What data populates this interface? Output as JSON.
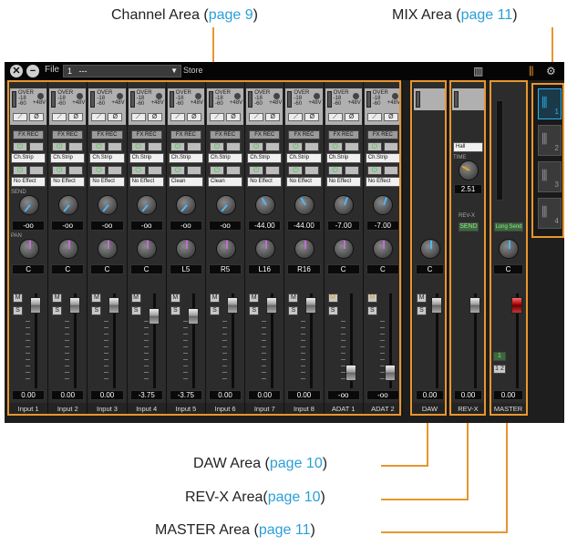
{
  "annotations": {
    "channel": {
      "label": "Channel Area (",
      "page": "page 9",
      ")": ")"
    },
    "mix": {
      "label": "MIX Area (",
      "page": "page 11"
    },
    "daw": {
      "label": "DAW Area (",
      "page": "page 10"
    },
    "revx": {
      "label": "REV-X Area(",
      "page": "page 10"
    },
    "master": {
      "label": "MASTER Area (",
      "page": "page 11"
    },
    "close": ")"
  },
  "titlebar": {
    "file_label": "File",
    "preset_number": "1",
    "preset_name": "---",
    "store_label": "Store"
  },
  "channel_common": {
    "over": "OVER",
    "m18": "-18",
    "m60": "-60",
    "v48": "+48V",
    "fx_rec": "FX REC",
    "send_label": "SEND",
    "pan_label": "PAN",
    "mute": "M",
    "solo": "S"
  },
  "channels": [
    {
      "name": "Input 1",
      "strip": "Ch.Strip",
      "effect": "No Effect",
      "send": "-oo",
      "pan": "C",
      "level": "0.00"
    },
    {
      "name": "Input 2",
      "strip": "Ch.Strip",
      "effect": "No Effect",
      "send": "-oo",
      "pan": "C",
      "level": "0.00"
    },
    {
      "name": "Input 3",
      "strip": "Ch.Strip",
      "effect": "No Effect",
      "send": "-oo",
      "pan": "C",
      "level": "0.00"
    },
    {
      "name": "Input 4",
      "strip": "Ch.Strip",
      "effect": "No Effect",
      "send": "-oo",
      "pan": "C",
      "level": "-3.75"
    },
    {
      "name": "Input 5",
      "strip": "Ch.Strip",
      "effect": "Clean",
      "send": "-oo",
      "pan": "L5",
      "level": "-3.75"
    },
    {
      "name": "Input 6",
      "strip": "Ch.Strip",
      "effect": "Clean",
      "send": "-oo",
      "pan": "R5",
      "level": "0.00"
    },
    {
      "name": "Input 7",
      "strip": "Ch.Strip",
      "effect": "No Effect",
      "send": "-44.00",
      "pan": "L16",
      "level": "0.00"
    },
    {
      "name": "Input 8",
      "strip": "Ch.Strip",
      "effect": "No Effect",
      "send": "-44.00",
      "pan": "R16",
      "level": "0.00"
    },
    {
      "name": "ADAT 1",
      "strip": "Ch.Strip",
      "effect": "No Effect",
      "send": "-7.00",
      "pan": "C",
      "level": "-oo"
    },
    {
      "name": "ADAT 2",
      "strip": "Ch.Strip",
      "effect": "No Effect",
      "send": "-7.00",
      "pan": "C",
      "level": "-oo"
    }
  ],
  "daw": {
    "name": "DAW",
    "pan": "C",
    "level": "0.00"
  },
  "revx": {
    "name": "REV-X",
    "type": "Hall",
    "time_label": "TIME",
    "time": "2.51",
    "revx_label": "REV-X",
    "send": "SEND",
    "level": "0.00"
  },
  "master": {
    "name": "MASTER",
    "long_send": "Long Send",
    "pan": "C",
    "level": "0.00",
    "btn1": "1",
    "btn2": "1 2"
  },
  "mix_buttons": [
    "1",
    "2",
    "3",
    "4"
  ],
  "colors": {
    "accent": "#e8962e",
    "link": "#2a9fd8",
    "mix_active": "#29b3ef"
  }
}
